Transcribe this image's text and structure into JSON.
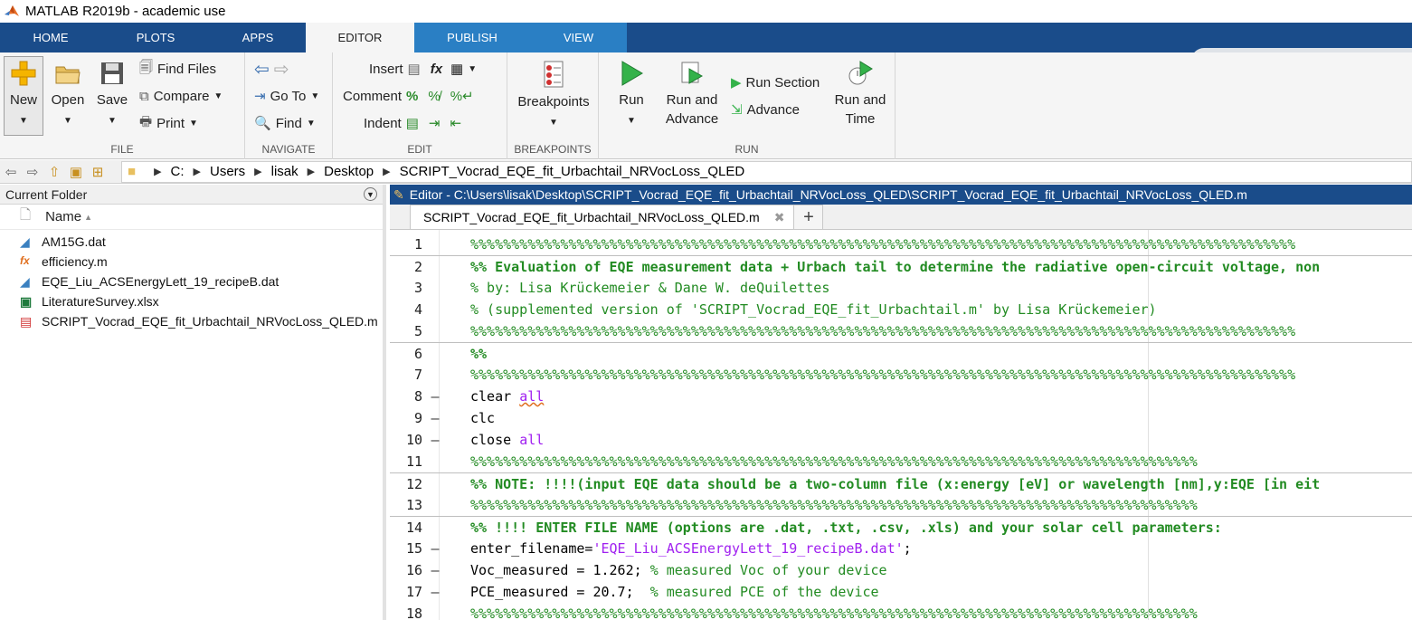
{
  "window": {
    "title": "MATLAB R2019b - academic use",
    "logo_icon": "matlab-logo-icon"
  },
  "tabs": [
    "HOME",
    "PLOTS",
    "APPS",
    "EDITOR",
    "PUBLISH",
    "VIEW"
  ],
  "active_tab": "EDITOR",
  "toolstrip": {
    "file": {
      "label": "FILE",
      "new": "New",
      "open": "Open",
      "save": "Save",
      "find_files": "Find Files",
      "compare": "Compare",
      "print": "Print"
    },
    "navigate": {
      "label": "NAVIGATE",
      "goto": "Go To",
      "find": "Find"
    },
    "edit": {
      "label": "EDIT",
      "insert": "Insert",
      "comment": "Comment",
      "indent": "Indent"
    },
    "breakpoints": {
      "label": "BREAKPOINTS",
      "breakpoints": "Breakpoints"
    },
    "run": {
      "label": "RUN",
      "run": "Run",
      "run_and_advance_1": "Run and",
      "run_and_advance_2": "Advance",
      "run_section": "Run Section",
      "advance": "Advance",
      "run_and_time_1": "Run and",
      "run_and_time_2": "Time"
    }
  },
  "address": {
    "crumbs": [
      "C:",
      "Users",
      "lisak",
      "Desktop",
      "SCRIPT_Vocrad_EQE_fit_Urbachtail_NRVocLoss_QLED"
    ]
  },
  "current_folder": {
    "title": "Current Folder",
    "column": "Name",
    "files": [
      {
        "name": "AM15G.dat",
        "icon": "data-file-icon"
      },
      {
        "name": "efficiency.m",
        "icon": "function-file-icon"
      },
      {
        "name": "EQE_Liu_ACSEnergyLett_19_recipeB.dat",
        "icon": "data-file-icon"
      },
      {
        "name": "LiteratureSurvey.xlsx",
        "icon": "excel-file-icon"
      },
      {
        "name": "SCRIPT_Vocrad_EQE_fit_Urbachtail_NRVocLoss_QLED.m",
        "icon": "script-file-icon"
      }
    ]
  },
  "editor": {
    "title": "Editor - C:\\Users\\lisak\\Desktop\\SCRIPT_Vocrad_EQE_fit_Urbachtail_NRVocLoss_QLED\\SCRIPT_Vocrad_EQE_fit_Urbachtail_NRVocLoss_QLED.m",
    "tab": "SCRIPT_Vocrad_EQE_fit_Urbachtail_NRVocLoss_QLED.m",
    "close_glyph": "✖",
    "add_glyph": "+",
    "lines": [
      {
        "n": "1",
        "dash": "",
        "parts": [
          {
            "t": "%%%%%%%%%%%%%%%%%%%%%%%%%%%%%%%%%%%%%%%%%%%%%%%%%%%%%%%%%%%%%%%%%%%%%%%%%%%%%%%%%%%%%%%%%%%%%%%%%%%%%",
            "c": "c-com"
          }
        ],
        "cell": false
      },
      {
        "n": "2",
        "dash": "",
        "parts": [
          {
            "t": "%% Evaluation of EQE measurement data + Urbach tail to determine the radiative open-circuit voltage, non",
            "c": "c-comb"
          }
        ],
        "cell": true
      },
      {
        "n": "3",
        "dash": "",
        "parts": [
          {
            "t": "% by: Lisa Krückemeier & Dane W. deQuilettes",
            "c": "c-com"
          }
        ],
        "cell": false
      },
      {
        "n": "4",
        "dash": "",
        "parts": [
          {
            "t": "% (supplemented version of 'SCRIPT_Vocrad_EQE_fit_Urbachtail.m' by Lisa Krückemeier)",
            "c": "c-com"
          }
        ],
        "cell": false
      },
      {
        "n": "5",
        "dash": "",
        "parts": [
          {
            "t": "%%%%%%%%%%%%%%%%%%%%%%%%%%%%%%%%%%%%%%%%%%%%%%%%%%%%%%%%%%%%%%%%%%%%%%%%%%%%%%%%%%%%%%%%%%%%%%%%%%%%%",
            "c": "c-com"
          }
        ],
        "cell": false
      },
      {
        "n": "6",
        "dash": "",
        "parts": [
          {
            "t": "%%",
            "c": "c-comb"
          }
        ],
        "cell": true
      },
      {
        "n": "7",
        "dash": "",
        "parts": [
          {
            "t": "%%%%%%%%%%%%%%%%%%%%%%%%%%%%%%%%%%%%%%%%%%%%%%%%%%%%%%%%%%%%%%%%%%%%%%%%%%%%%%%%%%%%%%%%%%%%%%%%%%%%%",
            "c": "c-com"
          }
        ],
        "cell": false
      },
      {
        "n": "8",
        "dash": "–",
        "parts": [
          {
            "t": "clear ",
            "c": "c-plain"
          },
          {
            "t": "all",
            "c": "c-kw underline-wavy"
          }
        ],
        "cell": false
      },
      {
        "n": "9",
        "dash": "–",
        "parts": [
          {
            "t": "clc",
            "c": "c-plain"
          }
        ],
        "cell": false
      },
      {
        "n": "10",
        "dash": "–",
        "parts": [
          {
            "t": "close ",
            "c": "c-plain"
          },
          {
            "t": "all",
            "c": "c-kw"
          }
        ],
        "cell": false
      },
      {
        "n": "11",
        "dash": "",
        "parts": [
          {
            "t": "%%%%%%%%%%%%%%%%%%%%%%%%%%%%%%%%%%%%%%%%%%%%%%%%%%%%%%%%%%%%%%%%%%%%%%%%%%%%%%%%%%%%%%%%%",
            "c": "c-com"
          }
        ],
        "cell": false
      },
      {
        "n": "12",
        "dash": "",
        "parts": [
          {
            "t": "%% NOTE: !!!!(input EQE data should be a two-column file (x:energy [eV] or wavelength [nm],y:EQE [in eit",
            "c": "c-comb"
          }
        ],
        "cell": true
      },
      {
        "n": "13",
        "dash": "",
        "parts": [
          {
            "t": "%%%%%%%%%%%%%%%%%%%%%%%%%%%%%%%%%%%%%%%%%%%%%%%%%%%%%%%%%%%%%%%%%%%%%%%%%%%%%%%%%%%%%%%%%",
            "c": "c-com"
          }
        ],
        "cell": false
      },
      {
        "n": "14",
        "dash": "",
        "parts": [
          {
            "t": "%% !!!! ENTER FILE NAME (options are .dat, .txt, .csv, .xls) and your solar cell parameters:",
            "c": "c-comb"
          }
        ],
        "cell": true
      },
      {
        "n": "15",
        "dash": "–",
        "parts": [
          {
            "t": "enter_filename=",
            "c": "c-plain"
          },
          {
            "t": "'EQE_Liu_ACSEnergyLett_19_recipeB.dat'",
            "c": "c-str"
          },
          {
            "t": ";",
            "c": "c-plain"
          }
        ],
        "cell": false
      },
      {
        "n": "16",
        "dash": "–",
        "parts": [
          {
            "t": "Voc_measured = 1.262; ",
            "c": "c-plain"
          },
          {
            "t": "% measured Voc of your device",
            "c": "c-com"
          }
        ],
        "cell": false
      },
      {
        "n": "17",
        "dash": "–",
        "parts": [
          {
            "t": "PCE_measured = 20.7;  ",
            "c": "c-plain"
          },
          {
            "t": "% measured PCE of the device",
            "c": "c-com"
          }
        ],
        "cell": false
      },
      {
        "n": "18",
        "dash": "",
        "parts": [
          {
            "t": "%%%%%%%%%%%%%%%%%%%%%%%%%%%%%%%%%%%%%%%%%%%%%%%%%%%%%%%%%%%%%%%%%%%%%%%%%%%%%%%%%%%%%%%%%",
            "c": "c-com"
          }
        ],
        "cell": false
      }
    ]
  },
  "colors": {
    "tabstrip": "#1a4c8a",
    "active_tab": "#f5f5f5",
    "comment": "#228b22",
    "string": "#a020f0"
  }
}
